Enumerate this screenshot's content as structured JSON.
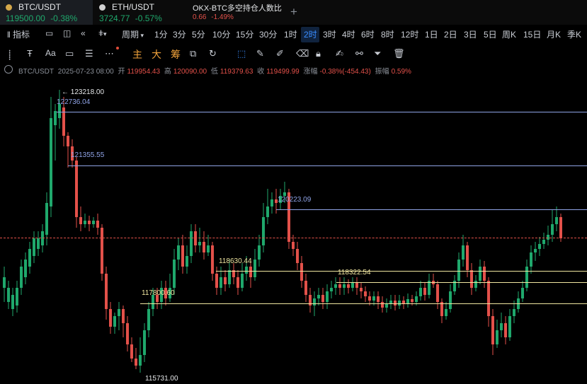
{
  "tabs": [
    {
      "name": "BTC/USDT",
      "price": "119500.00",
      "change": "-0.38%",
      "dot_color": "#d4a84a"
    },
    {
      "name": "ETH/USDT",
      "price": "3724.77",
      "change": "-0.57%",
      "dot_color": "#cfcfcf"
    },
    {
      "name": "OKX-BTC多空持仓人数比",
      "price": "0.66",
      "change": "-1.49%"
    }
  ],
  "add_tab_icon": "+",
  "toolbar": {
    "indicator_label": "指标",
    "period_label": "周期",
    "intervals": [
      "1分",
      "3分",
      "5分",
      "10分",
      "15分",
      "30分",
      "1时",
      "2时",
      "3时",
      "4时",
      "6时",
      "8时",
      "12时",
      "1日",
      "2日",
      "3日",
      "5日",
      "周K",
      "15日",
      "月K",
      "季K"
    ],
    "active_interval": "2时"
  },
  "toolbar2": {
    "main_label": "主",
    "big_label": "大",
    "chip_label": "筹"
  },
  "infobar": {
    "symbol": "BTC/USDT",
    "datetime": "2025-07-23 08:00",
    "open_label": "开",
    "open": "119954.43",
    "high_label": "高",
    "high": "120090.00",
    "low_label": "低",
    "low": "119379.63",
    "close_label": "收",
    "close": "119499.99",
    "change_label": "涨幅",
    "change": "-0.38%(-454.43)",
    "amp_label": "振幅",
    "amp": "0.59%"
  },
  "chart_labels": {
    "high_marker": "← 123218.00",
    "level1": "122736.04",
    "level2": "121355.55",
    "level3": "120223.09",
    "level4": "118630.44",
    "level5": "118322.54",
    "level6": "117800.60",
    "low_marker": "115731.00"
  },
  "colors": {
    "up": "#1fa86c",
    "down": "#e3514a",
    "accent": "#3a8dff",
    "brand": "#f0a23b"
  }
}
